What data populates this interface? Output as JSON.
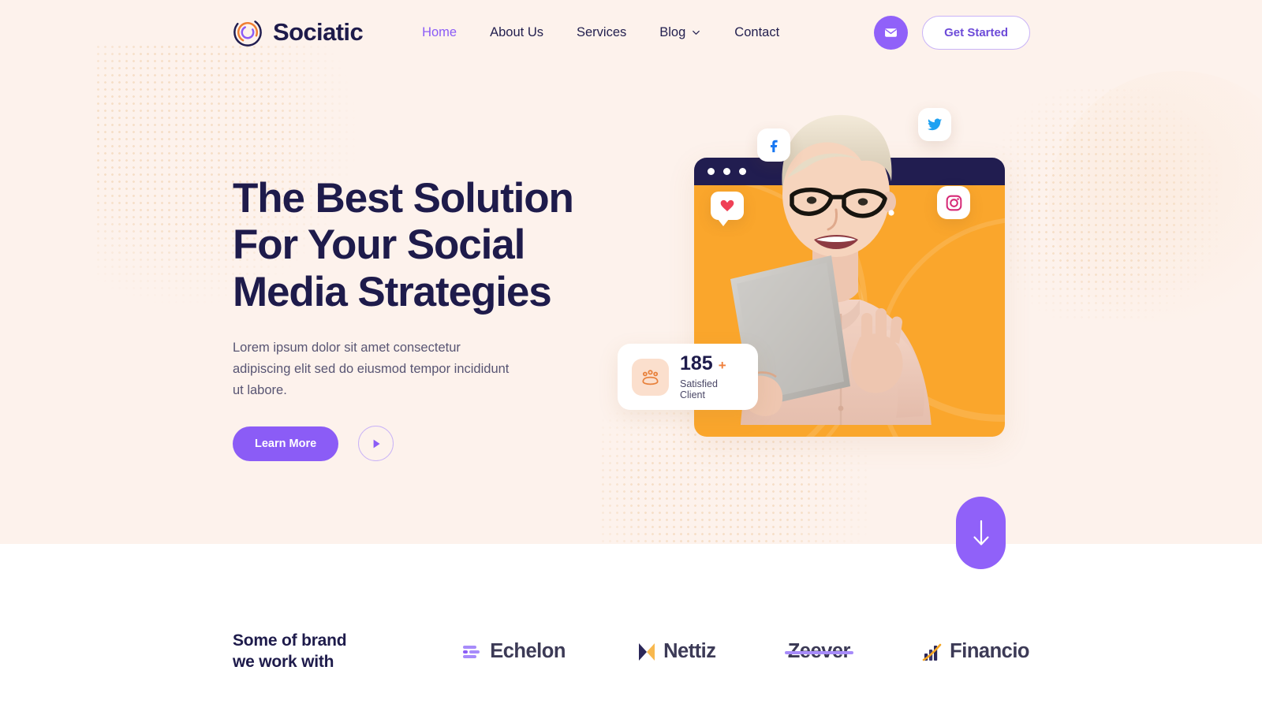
{
  "brand": {
    "name": "Sociatic",
    "logo_icon": "sociatic-ring-logo"
  },
  "nav": {
    "items": [
      {
        "label": "Home",
        "active": true,
        "has_dropdown": false
      },
      {
        "label": "About Us",
        "active": false,
        "has_dropdown": false
      },
      {
        "label": "Services",
        "active": false,
        "has_dropdown": false
      },
      {
        "label": "Blog",
        "active": false,
        "has_dropdown": true
      },
      {
        "label": "Contact",
        "active": false,
        "has_dropdown": false
      }
    ]
  },
  "header_actions": {
    "mail_icon": "envelope-icon",
    "cta_label": "Get Started"
  },
  "hero": {
    "title_line1": "The Best Solution",
    "title_line2": "For Your Social",
    "title_line3": "Media Strategies",
    "subtitle_line1": "Lorem ipsum dolor sit amet consectetur adipiscing",
    "subtitle_line2": "elit sed do eiusmod tempor incididunt ut labore.",
    "primary_button": "Learn More",
    "play_button_icon": "play-icon",
    "scroll_button_icon": "arrow-down-icon"
  },
  "social_chips": [
    {
      "name": "facebook-icon",
      "label": "Facebook"
    },
    {
      "name": "twitter-icon",
      "label": "Twitter"
    },
    {
      "name": "instagram-icon",
      "label": "Instagram"
    },
    {
      "name": "heart-icon",
      "label": "Like"
    }
  ],
  "stats_card": {
    "icon": "people-group-icon",
    "value": "185",
    "plus": "+",
    "label": "Satisfied Client"
  },
  "brands": {
    "heading_line1": "Some of brand",
    "heading_line2": "we work with",
    "logos": [
      {
        "name": "Echelon",
        "icon": "bars-list-icon"
      },
      {
        "name": "Nettiz",
        "icon": "bowtie-icon"
      },
      {
        "name": "Zeever",
        "icon": "strikethrough-icon"
      },
      {
        "name": "Financio",
        "icon": "bar-chart-swoosh-icon"
      }
    ]
  },
  "colors": {
    "hero_background": "#fdf2ec",
    "page_background": "#ffffff",
    "navy": "#1e1b4b",
    "purple": "#8b5cf6",
    "purple_deep": "#9061f9",
    "orange": "#faa62c",
    "orange_accent": "#f0803c",
    "twitter_blue": "#1da1f2",
    "facebook_blue": "#1877f2",
    "heart_red": "#ef4056"
  }
}
